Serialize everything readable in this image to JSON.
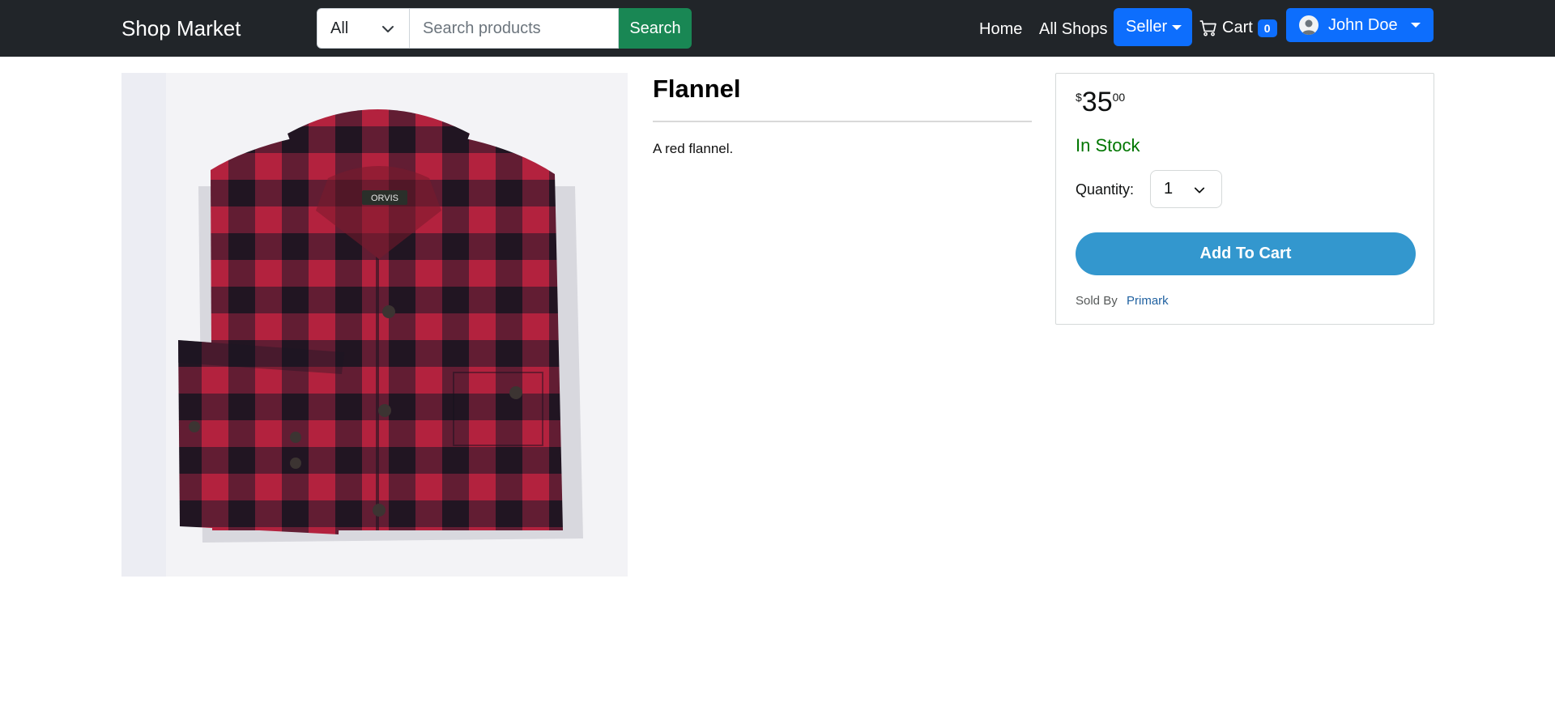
{
  "navbar": {
    "brand": "Shop Market",
    "search": {
      "category": "All",
      "placeholder": "Search products",
      "button_label": "Search"
    },
    "links": {
      "home": "Home",
      "all_shops": "All Shops"
    },
    "seller_label": "Seller",
    "cart": {
      "label": "Cart",
      "count": "0"
    },
    "user_name": "John Doe"
  },
  "product": {
    "title": "Flannel",
    "description": "A red flannel.",
    "image_logo_text": "ORVIS"
  },
  "buy_box": {
    "price": {
      "currency": "$",
      "whole": "35",
      "fraction": "00"
    },
    "stock_status": "In Stock",
    "quantity_label": "Quantity:",
    "quantity_value": "1",
    "add_to_cart_label": "Add To Cart",
    "sold_by_label": "Sold By",
    "seller_name": "Primark"
  },
  "colors": {
    "navbar_bg": "#212529",
    "primary": "#0d6efd",
    "search_button": "#198754",
    "add_to_cart": "#3397ce",
    "in_stock": "#007600",
    "link": "#2162a1"
  }
}
